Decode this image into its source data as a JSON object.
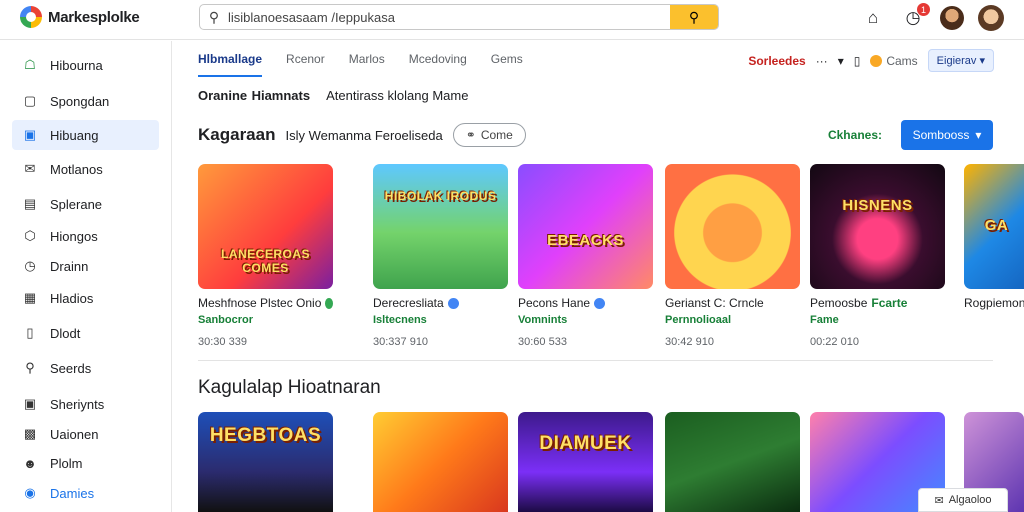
{
  "app": {
    "name": "Markesplolke"
  },
  "search": {
    "value": "lisiblanoesasaam /Ieppukasa",
    "placeholder": ""
  },
  "topbar": {
    "notification_count": "1"
  },
  "sidebar": {
    "items": [
      {
        "label": "Hibourna",
        "icon": "home-icon"
      },
      {
        "label": "Spongdan",
        "icon": "sparkle-icon"
      },
      {
        "label": "Hibuang",
        "icon": "store-icon"
      },
      {
        "label": "Motlanos",
        "icon": "mail-icon"
      },
      {
        "label": "Splerane",
        "icon": "document-icon"
      },
      {
        "label": "Hiongos",
        "icon": "hexagon-icon"
      },
      {
        "label": "Drainn",
        "icon": "clock-icon"
      },
      {
        "label": "Hladios",
        "icon": "grid-icon"
      },
      {
        "label": "Dlodt",
        "icon": "ticket-icon"
      },
      {
        "label": "Seerds",
        "icon": "search-icon"
      },
      {
        "label": "Sheriynts",
        "icon": "bookmark-icon"
      },
      {
        "label": "Uaionen",
        "icon": "gift-icon"
      },
      {
        "label": "Plolm",
        "icon": "person-icon"
      },
      {
        "label": "Damies",
        "icon": "circle-icon"
      }
    ]
  },
  "tabs": [
    {
      "label": "Hlbmallage"
    },
    {
      "label": "Rcenor"
    },
    {
      "label": "Marlos"
    },
    {
      "label": "Mcedoving"
    },
    {
      "label": "Gems"
    }
  ],
  "tab_right": {
    "sort_label": "Sorleedes",
    "dots": "···",
    "games": "Cams",
    "dropdown": "Eigierav"
  },
  "subtitle": {
    "main": "Oranine",
    "rest": "Hiamnats",
    "extra": "Atentirass klolang Mame"
  },
  "section1": {
    "title": "Kagaraan",
    "subtitle": "Isly Wemanma Feroeliseda",
    "come_label": "Come",
    "link_label": "Ckhanes:",
    "button_label": "Sombooss"
  },
  "cards": [
    {
      "title": "Meshfnose Plstec Onio",
      "sub": "Sanbocror",
      "num": "30:30 339",
      "art": "LANECEROAS COMES",
      "dot": "#34a853"
    },
    {
      "title": "Derecresliata",
      "sub": "Isltecnens",
      "num": "30:337 910",
      "art": "HIBOLAK IRODUS",
      "dot": "#4285f4"
    },
    {
      "title": "Pecons Hane",
      "sub": "Vomnints",
      "num": "30:60 533",
      "art": "EBEACKS",
      "dot": "#4285f4"
    },
    {
      "title": "Gerianst C: Crncle",
      "sub": "Pernnolioaal",
      "num": "30:42 910",
      "art": "",
      "dot": ""
    },
    {
      "title": "Pemoosbe",
      "title_green": "Fcarte",
      "sub": "Fame",
      "num": "00:22 010",
      "art": "HISNENS",
      "dot": ""
    },
    {
      "title": "Rogpiemone",
      "sub": "",
      "num": "",
      "art": "GA",
      "dot": ""
    }
  ],
  "section2": {
    "title": "Kagulalap Hioatnaran"
  },
  "cards2": [
    {
      "art": "HEGBTOAS"
    },
    {
      "art": ""
    },
    {
      "art": "DIAMUEK"
    },
    {
      "art": ""
    },
    {
      "art": ""
    },
    {
      "art": ""
    }
  ],
  "float_button": {
    "label": "Algaoloo"
  }
}
